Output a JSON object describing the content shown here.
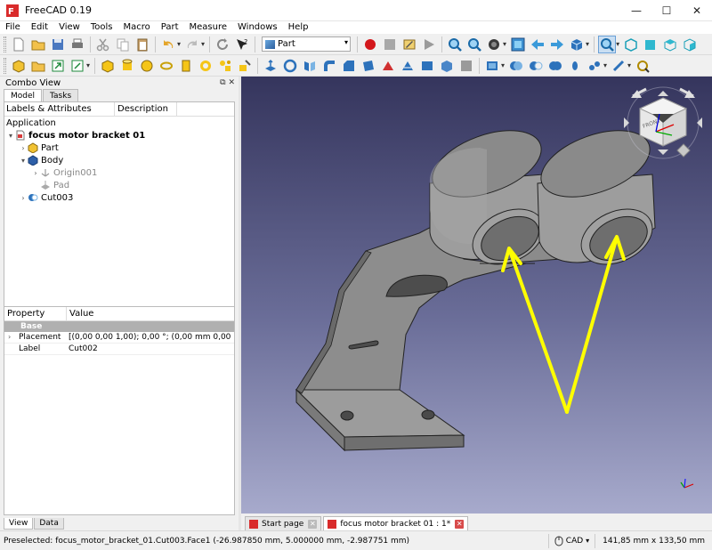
{
  "window": {
    "title": "FreeCAD 0.19",
    "minimize": "—",
    "maximize": "☐",
    "close": "✕"
  },
  "menu": [
    "File",
    "Edit",
    "View",
    "Tools",
    "Macro",
    "Part",
    "Measure",
    "Windows",
    "Help"
  ],
  "toolbar": {
    "workbench": "Part"
  },
  "combo_view": {
    "title": "Combo View",
    "tabs": [
      "Model",
      "Tasks"
    ],
    "tree": {
      "col_labels": "Labels & Attributes",
      "col_description": "Description",
      "section": "Application",
      "items": [
        {
          "label": "focus motor bracket 01",
          "level": 0,
          "expand": "▾",
          "icon": "document-icon"
        },
        {
          "label": "Part",
          "level": 1,
          "expand": "›",
          "icon": "part-icon"
        },
        {
          "label": "Body",
          "level": 1,
          "expand": "▾",
          "icon": "body-icon"
        },
        {
          "label": "Origin001",
          "level": 2,
          "expand": "›",
          "icon": "origin-icon"
        },
        {
          "label": "Pad",
          "level": 2,
          "expand": "",
          "icon": "pad-icon"
        },
        {
          "label": "Cut003",
          "level": 1,
          "expand": "›",
          "icon": "cut-icon"
        }
      ]
    },
    "properties": {
      "col_property": "Property",
      "col_value": "Value",
      "group": "Base",
      "rows": [
        {
          "name": "Placement",
          "value": "[(0,00 0,00 1,00); 0,00 °; (0,00 mm  0,00 mm  0,00 ...",
          "expand": "›"
        },
        {
          "name": "Label",
          "value": "Cut002",
          "expand": ""
        }
      ]
    },
    "bottom_tabs": [
      "View",
      "Data"
    ]
  },
  "navcube": {
    "face_label": "FRONT"
  },
  "doc_tabs": [
    {
      "label": "Start page",
      "active": false
    },
    {
      "label": "focus motor bracket 01 : 1*",
      "active": true
    }
  ],
  "status": {
    "message": "Preselected: focus_motor_bracket_01.Cut003.Face1 (-26.987850 mm, 5.000000 mm, -2.987751 mm)",
    "navigation": "CAD",
    "dimensions": "141,85 mm x 133,50 mm"
  },
  "colors": {
    "arrow": "#ffff00",
    "part_face": "#9a9a9a",
    "viewport_top": "#35355d",
    "viewport_bottom": "#a7aacc"
  }
}
